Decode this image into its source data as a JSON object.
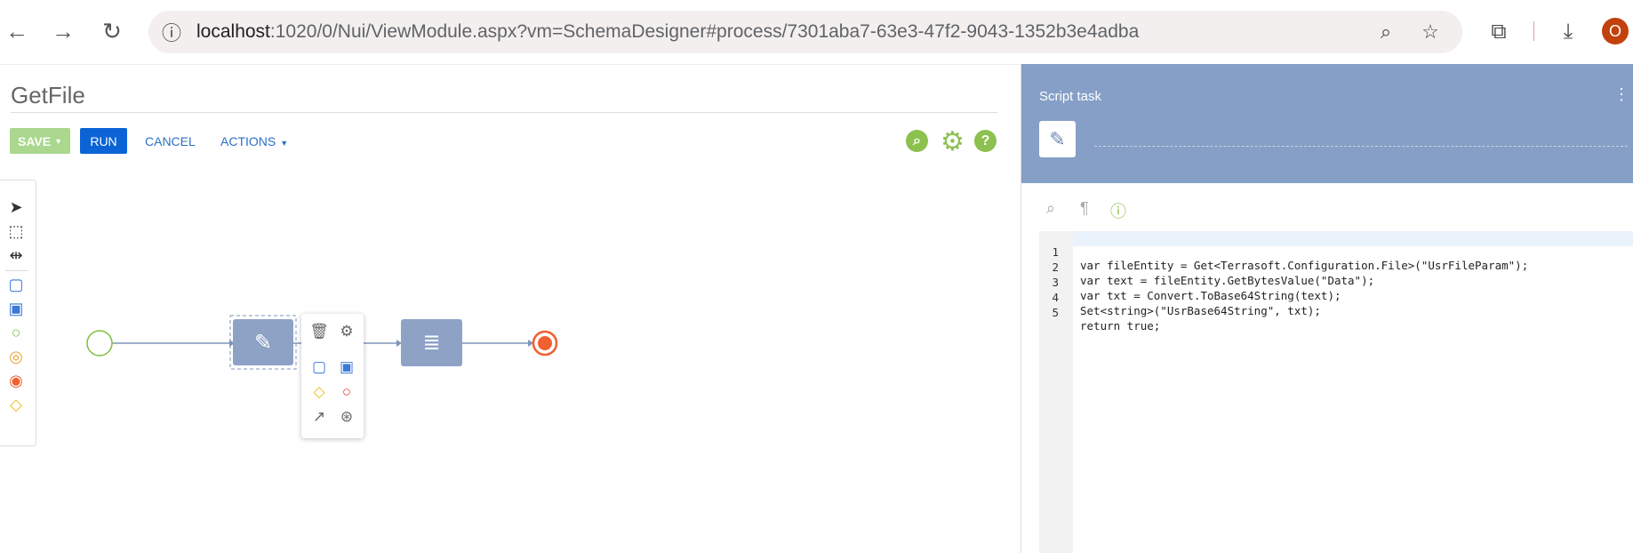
{
  "browser": {
    "url_host": "localhost",
    "url_path": ":1020/0/Nui/ViewModule.aspx?vm=SchemaDesigner#process/7301aba7-63e3-47f2-9043-1352b3e4adba",
    "avatar_letter": "O"
  },
  "designer": {
    "title": "GetFile",
    "save_label": "SAVE",
    "run_label": "RUN",
    "cancel_label": "CANCEL",
    "actions_label": "ACTIONS",
    "help_label": "?",
    "accent_color": "#8cc04f",
    "run_color": "#0b63d6"
  },
  "panel": {
    "title": "Script task",
    "menu_glyph": "⋮",
    "code": [
      {
        "n": "1",
        "text": "var fileEntity = Get<Terrasoft.Configuration.File>(\"UsrFileParam\");"
      },
      {
        "n": "2",
        "text": "var text = fileEntity.GetBytesValue(\"Data\");"
      },
      {
        "n": "3",
        "text": "var txt = Convert.ToBase64String(text);"
      },
      {
        "n": "4",
        "text": "Set<string>(\"UsrBase64String\", txt);"
      },
      {
        "n": "5",
        "text": "return true;"
      }
    ],
    "header_color": "#869fc6"
  }
}
